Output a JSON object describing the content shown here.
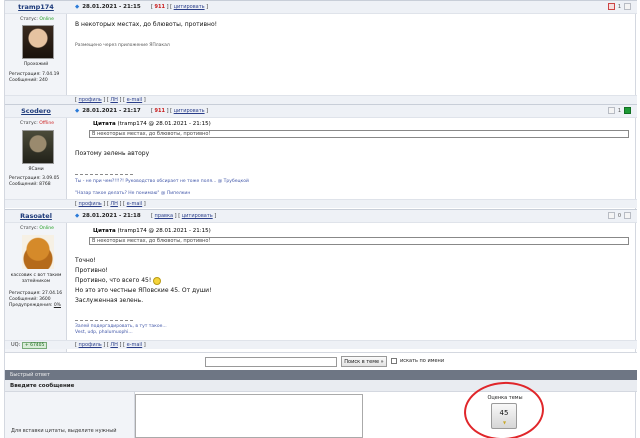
{
  "posts": [
    {
      "username": "tramp174",
      "status_label": "Статус:",
      "status_value": "Online",
      "user_title": "Прохожий",
      "reg_label": "Регистрация: 7.04.19",
      "msgs_label": "Сообщений: 240",
      "time": "28.01.2021 - 21:15",
      "number": "911",
      "quote_link": "цитировать",
      "text": "В некоторых местах, до блювоты, противно!",
      "app_note": "Размещено через приложение ЯПлакал",
      "rating": "1",
      "footer": [
        "профиль",
        "ЛН",
        "e-mail"
      ]
    },
    {
      "username": "Scodero",
      "status_label": "Статус:",
      "status_value": "Offline",
      "user_title": "ЯСами",
      "reg_label": "Регистрация: 3.09.05",
      "msgs_label": "Сообщений: 8768",
      "time": "28.01.2021 - 21:17",
      "number": "911",
      "quote_link": "цитировать",
      "quote_title": "Цитата",
      "quote_author": "(tramp174 @ 28.01.2021 - 21:15)",
      "quote_text": "В некоторых местах, до блювоты, противно!",
      "text": "Поэтому зелень автору",
      "sig1": "Ты - не при чем?!!!?! Руководство обсирает не тоже поля... @ Трубецкой",
      "sig2": "\"Назар такое делать? Не понимаю\" @ Пипелкин",
      "rating": "1",
      "footer": [
        "профиль",
        "ЛН",
        "e-mail"
      ]
    },
    {
      "username": "Rasoatel",
      "status_label": "Статус:",
      "status_value": "Online",
      "user_title": "кассовик с вот таким затейником",
      "reg_label": "Регистрация: 27.04.16",
      "msgs_label": "Сообщений: 3600",
      "warn_label": "Предупреждения:",
      "warn_value": "0%",
      "time": "28.01.2021 - 21:18",
      "number": "правка",
      "quote_link": "цитировать",
      "quote_title": "Цитата",
      "quote_author": "(tramp174 @ 28.01.2021 - 21:15)",
      "quote_text": "В некоторых местах, до блювоты, противно!",
      "lines": [
        "Точно!",
        "Противно!",
        "Противно, что всего 45!",
        "Но это это честные ЯПовские 45. От души!",
        "Заслуженная зелень."
      ],
      "sig1": "Залей подергадировать, в тут такое...",
      "sig2": "Vest, udp, phalumuophi...",
      "rating": "0",
      "uq_label": "UQ:",
      "uq_value": "+ 67405",
      "footer": [
        "профиль",
        "ЛН",
        "e-mail"
      ]
    }
  ],
  "search": {
    "button": "Поиск в теме »",
    "checkbox_label": "искать по имени"
  },
  "quick_reply": {
    "header": "Быстрый ответ",
    "compose_header": "Введите сообщение",
    "hint": "Для вставки цитаты, выделите нужный",
    "rating_label": "Оценка темы",
    "rating_value": "45"
  },
  "colors": {
    "online": "#1a9a1a",
    "offline": "#cc2222",
    "highlight_circle": "#e0262a",
    "header_bar": "#6e7684"
  },
  "icons": [
    "post-dot-icon",
    "rating-minus-icon",
    "rating-plus-icon",
    "smiley-icon"
  ]
}
